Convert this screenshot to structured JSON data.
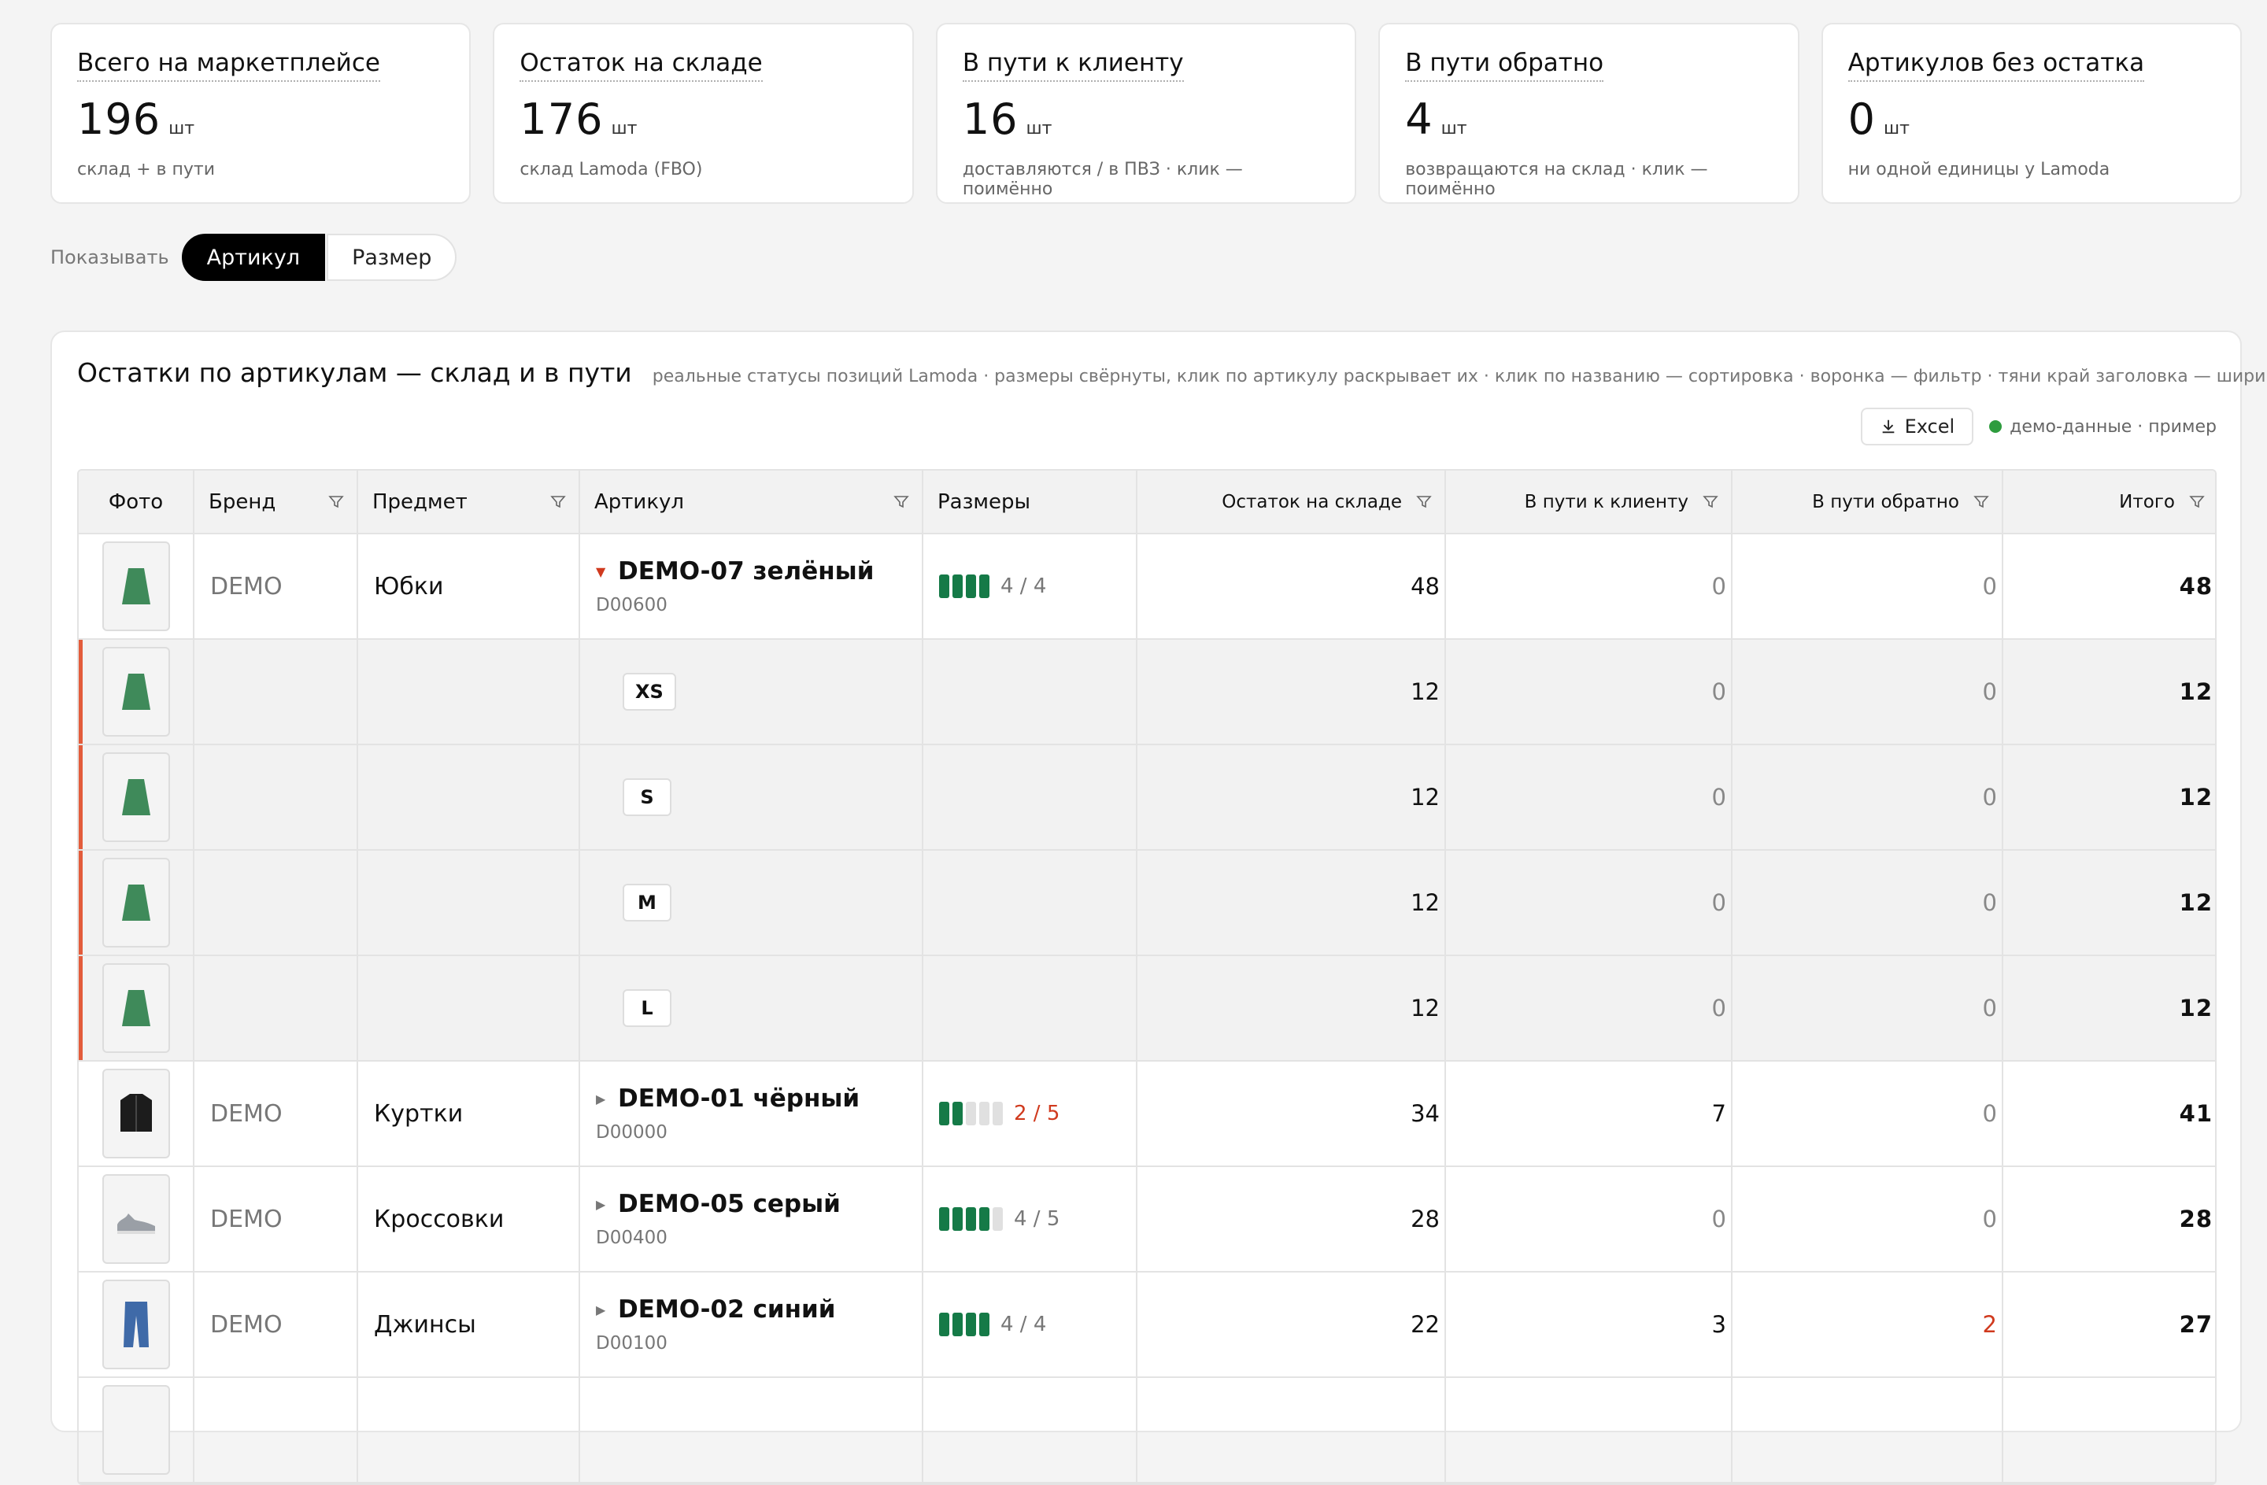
{
  "cards": [
    {
      "title": "Всего на маркетплейсе",
      "value": "196",
      "unit": "шт",
      "sub": "склад + в пути"
    },
    {
      "title": "Остаток на складе",
      "value": "176",
      "unit": "шт",
      "sub": "склад Lamoda (FBO)"
    },
    {
      "title": "В пути к клиенту",
      "value": "16",
      "unit": "шт",
      "sub": "доставляются / в ПВЗ · клик — поимённо"
    },
    {
      "title": "В пути обратно",
      "value": "4",
      "unit": "шт",
      "sub": "возвращаются на склад · клик — поимённо"
    },
    {
      "title": "Артикулов без остатка",
      "value": "0",
      "unit": "шт",
      "sub": "ни одной единицы у Lamoda"
    }
  ],
  "toggle": {
    "label": "Показывать",
    "options": [
      "Артикул",
      "Размер"
    ],
    "active": "Артикул"
  },
  "panel": {
    "title": "Остатки по артикулам — склад и в пути",
    "hint": "реальные статусы позиций Lamoda · размеры свёрнуты, клик по артикулу раскрывает их · клик по названию — сортировка · воронка — фильтр · тяни край заголовка — ширина",
    "excel_label": "Excel",
    "demo_note": "демо-данные · пример"
  },
  "columns": {
    "photo": "Фото",
    "brand": "Бренд",
    "subject": "Предмет",
    "article": "Артикул",
    "sizes": "Размеры",
    "stock": "Остаток на складе",
    "to_client": "В пути к клиенту",
    "back": "В пути обратно",
    "total": "Итого"
  },
  "rows": [
    {
      "brand": "DEMO",
      "subject": "Юбки",
      "name": "DEMO-07 зелёный",
      "code": "D00600",
      "sizes_on": 4,
      "sizes_total": 4,
      "sizes_text": "4 / 4",
      "stock": "48",
      "to_client": "0",
      "back": "0",
      "total": "48",
      "icon": "skirt-icon"
    },
    {
      "size": "XS",
      "stock": "12",
      "to_client": "0",
      "back": "0",
      "total": "12",
      "icon": "skirt-icon"
    },
    {
      "size": "S",
      "stock": "12",
      "to_client": "0",
      "back": "0",
      "total": "12",
      "icon": "skirt-icon"
    },
    {
      "size": "M",
      "stock": "12",
      "to_client": "0",
      "back": "0",
      "total": "12",
      "icon": "skirt-icon"
    },
    {
      "size": "L",
      "stock": "12",
      "to_client": "0",
      "back": "0",
      "total": "12",
      "icon": "skirt-icon"
    },
    {
      "brand": "DEMO",
      "subject": "Куртки",
      "name": "DEMO-01 чёрный",
      "code": "D00000",
      "sizes_on": 2,
      "sizes_total": 5,
      "sizes_text": "2 / 5",
      "stock": "34",
      "to_client": "7",
      "back": "0",
      "total": "41",
      "icon": "jacket-icon"
    },
    {
      "brand": "DEMO",
      "subject": "Кроссовки",
      "name": "DEMO-05 серый",
      "code": "D00400",
      "sizes_on": 4,
      "sizes_total": 5,
      "sizes_text": "4 / 5",
      "stock": "28",
      "to_client": "0",
      "back": "0",
      "total": "28",
      "icon": "sneaker-icon"
    },
    {
      "brand": "DEMO",
      "subject": "Джинсы",
      "name": "DEMO-02 синий",
      "code": "D00100",
      "sizes_on": 4,
      "sizes_total": 4,
      "sizes_text": "4 / 4",
      "stock": "22",
      "to_client": "3",
      "back": "2",
      "total": "27",
      "icon": "jeans-icon"
    }
  ],
  "colors": {
    "accent": "#157a47",
    "alert": "#d03a1e",
    "expand_marker": "#e35c3b"
  }
}
